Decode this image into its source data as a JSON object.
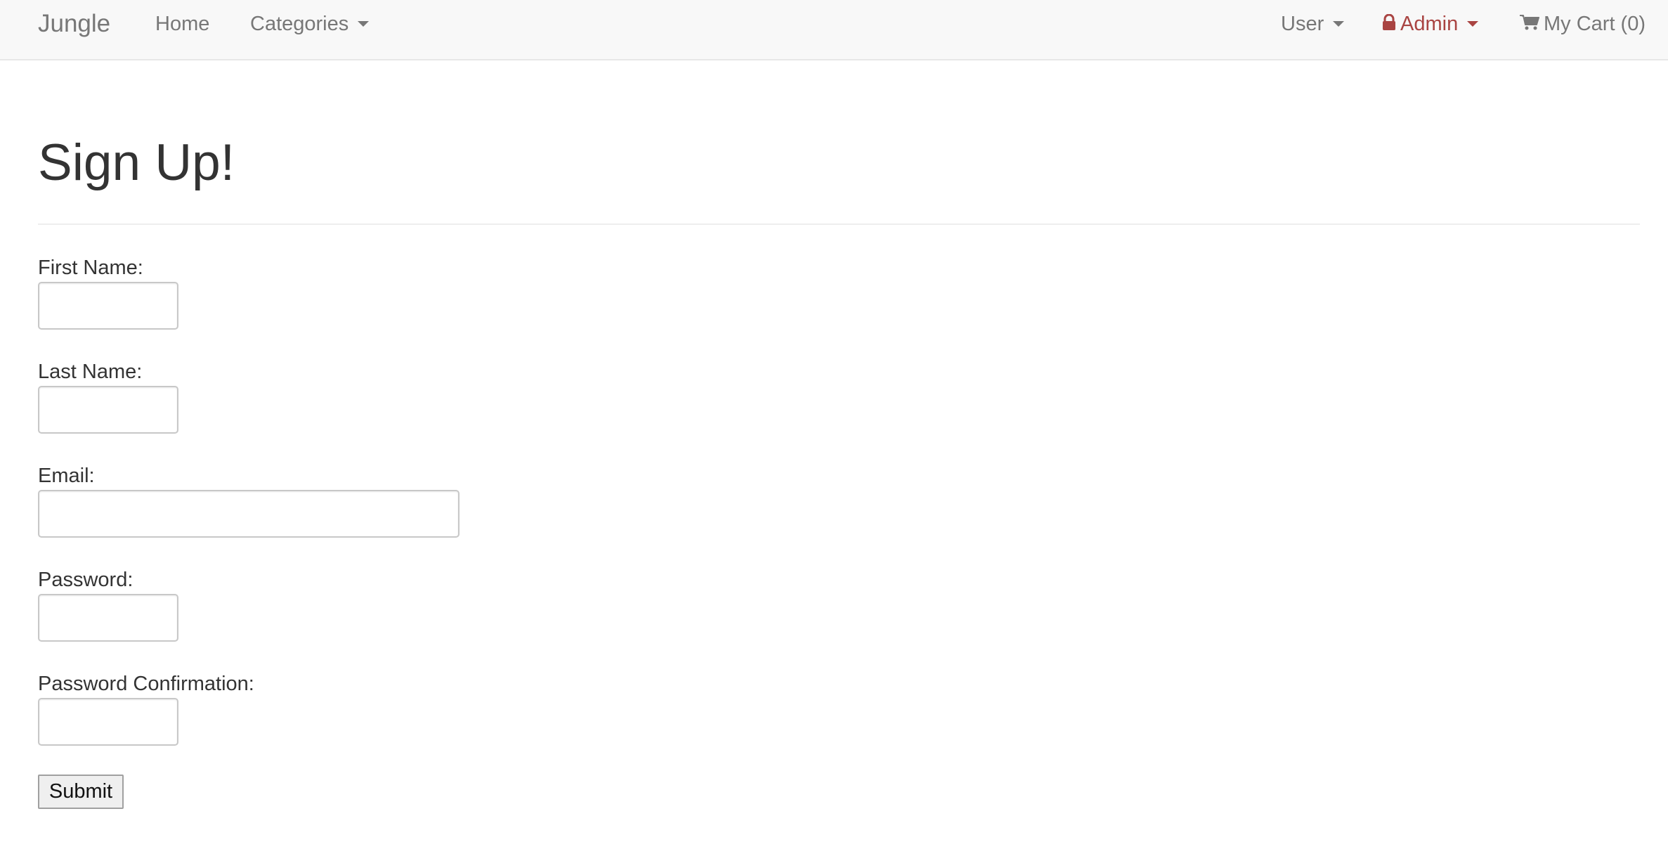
{
  "navbar": {
    "brand": "Jungle",
    "home": "Home",
    "categories": "Categories",
    "user": "User",
    "admin": "Admin",
    "cart": "My Cart (0)",
    "admin_color": "#a94442",
    "link_color": "#777777",
    "icons": {
      "admin": "lock-icon",
      "cart": "shopping-cart-icon",
      "dropdown": "caret-down-icon"
    }
  },
  "page": {
    "title": "Sign Up!"
  },
  "form": {
    "first_name": {
      "label": "First Name:",
      "value": ""
    },
    "last_name": {
      "label": "Last Name:",
      "value": ""
    },
    "email": {
      "label": "Email:",
      "value": ""
    },
    "password": {
      "label": "Password:",
      "value": ""
    },
    "password_confirmation": {
      "label": "Password Confirmation:",
      "value": ""
    },
    "submit_label": "Submit"
  }
}
